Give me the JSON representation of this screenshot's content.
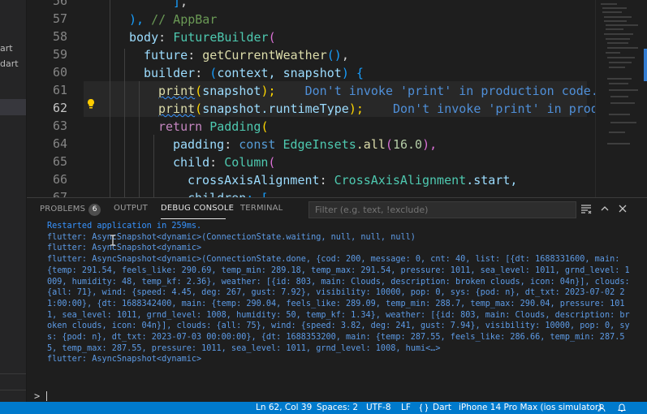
{
  "sidebar": {
    "items": [
      {
        "label": "art"
      },
      {
        "label": "dart"
      }
    ]
  },
  "editor": {
    "lines": [
      {
        "num": "56"
      },
      {
        "num": "57"
      },
      {
        "num": "58"
      },
      {
        "num": "59"
      },
      {
        "num": "60"
      },
      {
        "num": "61"
      },
      {
        "num": "62"
      },
      {
        "num": "63"
      },
      {
        "num": "64"
      },
      {
        "num": "65"
      },
      {
        "num": "66"
      },
      {
        "num": "67"
      }
    ],
    "code": {
      "l57_close": "), ",
      "l57_comment": "// AppBar",
      "l58_prop": "body",
      "l58_colon": ": ",
      "l58_type": "FutureBuilder",
      "l58_paren": "(",
      "l59_prop": "future",
      "l59_colon": ": ",
      "l59_fn": "getCurrentWeather",
      "l59_call": "()",
      "l59_comma": ",",
      "l60_prop": "builder",
      "l60_colon": ": ",
      "l60_open": "(",
      "l60_args": "context, snapshot",
      "l60_close": ")",
      "l60_brace": " {",
      "l61_fn": "print",
      "l61_open": "(",
      "l61_arg": "snapshot",
      "l61_close": ");",
      "l61_ghost": "Don't invoke 'print' in production code.",
      "l62_fn": "print",
      "l62_open": "(",
      "l62_arg": "snapshot.runtimeType",
      "l62_close": ");",
      "l62_ghost": "Don't invoke 'print' in production code.",
      "l63_kw": "return",
      "l63_type": "Padding",
      "l63_paren": "(",
      "l64_prop": "padding",
      "l64_colon": ": ",
      "l64_kw": "const",
      "l64_type": "EdgeInsets",
      "l64_fn": ".all",
      "l64_num": "16.0",
      "l64_tail": "),",
      "l65_prop": "child",
      "l65_colon": ": ",
      "l65_type": "Column",
      "l65_paren": "(",
      "l66_prop": "crossAxisAlignment",
      "l66_colon": ": ",
      "l66_type": "CrossAxisAlignment",
      "l66_tail": ".start,",
      "l67_prop": "children",
      "l67_tail": ": ["
    }
  },
  "panel": {
    "tabs": [
      {
        "label": "PROBLEMS",
        "badge": "6"
      },
      {
        "label": "OUTPUT"
      },
      {
        "label": "DEBUG CONSOLE"
      },
      {
        "label": "TERMINAL"
      }
    ],
    "filter_placeholder": "Filter (e.g. text, !exclude)",
    "console_lines": [
      {
        "kind": "info",
        "text": "Restarted application in 259ms."
      },
      {
        "kind": "out",
        "text": "flutter: AsyncSnapshot<dynamic>(ConnectionState.waiting, null, null, null)"
      },
      {
        "kind": "out",
        "text": "flutter: AsyncSnapshot<dynamic>"
      },
      {
        "kind": "out",
        "text": "flutter: AsyncSnapshot<dynamic>(ConnectionState.done, {cod: 200, message: 0, cnt: 40, list: [{dt: 1688331600, main: {temp: 291.54, feels_like: 290.69, temp_min: 289.18, temp_max: 291.54, pressure: 1011, sea_level: 1011, grnd_level: 1009, humidity: 48, temp_kf: 2.36}, weather: [{id: 803, main: Clouds, description: broken clouds, icon: 04n}], clouds: {all: 71}, wind: {speed: 4.45, deg: 267, gust: 7.92}, visibility: 10000, pop: 0, sys: {pod: n}, dt_txt: 2023-07-02 21:00:00}, {dt: 1688342400, main: {temp: 290.04, feels_like: 289.09, temp_min: 288.7, temp_max: 290.04, pressure: 1011, sea_level: 1011, grnd_level: 1008, humidity: 50, temp_kf: 1.34}, weather: [{id: 803, main: Clouds, description: broken clouds, icon: 04n}], clouds: {all: 75}, wind: {speed: 3.82, deg: 241, gust: 7.94}, visibility: 10000, pop: 0, sys: {pod: n}, dt_txt: 2023-07-03 00:00:00}, {dt: 1688353200, main: {temp: 287.55, feels_like: 286.66, temp_min: 287.55, temp_max: 287.55, pressure: 1011, sea_level: 1011, grnd_level: 1008, humi<…>"
      },
      {
        "kind": "out",
        "text": "flutter: AsyncSnapshot<dynamic>"
      }
    ],
    "prompt": ">"
  },
  "status_bar": {
    "position": "Ln 62, Col 39",
    "spaces": "Spaces: 2",
    "encoding": "UTF-8",
    "eol": "LF",
    "language": "Dart",
    "device": "iPhone 14 Pro Max (ios simulator)"
  },
  "colors": {
    "background": "#1e1e1e",
    "status_bar": "#007acc",
    "console_text": "#5d9be6",
    "ghost_text": "#4f8fd8"
  }
}
